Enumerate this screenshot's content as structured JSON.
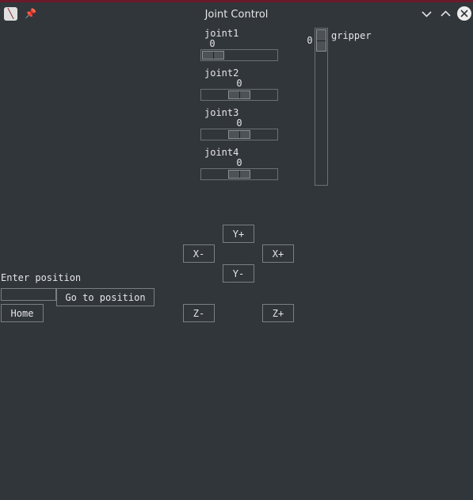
{
  "window": {
    "title": "Joint Control",
    "app_icon": "app-icon",
    "pin_icon": "pin-icon",
    "controls": [
      "minimize-icon",
      "maximize-icon",
      "close-icon"
    ]
  },
  "joints": [
    {
      "label": "joint1",
      "value": "0",
      "position_fraction": 0.0
    },
    {
      "label": "joint2",
      "value": "0",
      "position_fraction": 0.5
    },
    {
      "label": "joint3",
      "value": "0",
      "position_fraction": 0.5
    },
    {
      "label": "joint4",
      "value": "0",
      "position_fraction": 0.5
    }
  ],
  "gripper": {
    "label": "gripper",
    "value": "0",
    "position_fraction": 0.0
  },
  "jog": {
    "y_plus": "Y+",
    "y_minus": "Y-",
    "x_minus": "X-",
    "x_plus": "X+",
    "z_minus": "Z-",
    "z_plus": "Z+"
  },
  "position": {
    "prompt": "Enter position",
    "input_value": "",
    "go_label": "Go to position",
    "home_label": "Home"
  }
}
